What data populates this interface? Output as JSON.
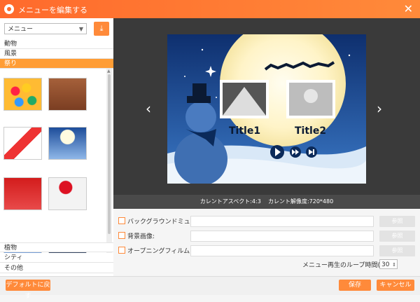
{
  "window": {
    "title": "メニューを編集する"
  },
  "sidebar": {
    "dropdown_value": "メニュー",
    "categories_top": [
      "動物",
      "風景",
      "祭り"
    ],
    "selected_index": 2,
    "categories_bottom": [
      "植物",
      "シティ",
      "その他"
    ]
  },
  "preview": {
    "title1": "Title1",
    "title2": "Title2",
    "aspect": "カレントアスペクト:4:3",
    "resolution": "カレント解像度:720*480"
  },
  "options": {
    "bgm_label": "バックグラウンドミュージック:",
    "bg_image_label": "背景画像:",
    "opening_label": "オープニングフィルム:",
    "browse": "参照",
    "loop_label": "メニュー再生のループ時間(秒):",
    "loop_value": "30"
  },
  "footer": {
    "default": "デフォルトに戻す",
    "save": "保存",
    "cancel": "キャンセル"
  },
  "colors": {
    "accent": "#ff8a3a",
    "selected": "#ff9d35"
  }
}
